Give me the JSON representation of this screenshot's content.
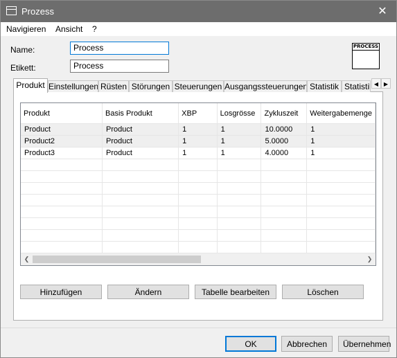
{
  "window": {
    "title": "Prozess"
  },
  "menu": [
    "Navigieren",
    "Ansicht",
    "?"
  ],
  "form": {
    "name_label": "Name:",
    "name_value": "Process",
    "etikett_label": "Etikett:",
    "etikett_value": "Process"
  },
  "icon_label": "PROCESS",
  "tabs": [
    "Produkt",
    "Einstellungen",
    "Rüsten",
    "Störungen",
    "Steuerungen",
    "Ausgangssteuerungen",
    "Statistik",
    "Statistik"
  ],
  "active_tab": "Produkt",
  "table": {
    "columns": [
      "Produkt",
      "Basis Produkt",
      "XBP",
      "Losgrösse",
      "Zykluszeit",
      "Weitergabemenge"
    ],
    "rows": [
      [
        "Product",
        "Product",
        "1",
        "1",
        "10.0000",
        "1"
      ],
      [
        "Product2",
        "Product",
        "1",
        "1",
        "5.0000",
        "1"
      ],
      [
        "Product3",
        "Product",
        "1",
        "1",
        "4.0000",
        "1"
      ]
    ]
  },
  "actions": {
    "add": "Hinzufügen",
    "change": "Ändern",
    "edit_table": "Tabelle bearbeiten",
    "delete": "Löschen"
  },
  "dialog_buttons": {
    "ok": "OK",
    "cancel": "Abbrechen",
    "apply": "Übernehmen"
  }
}
